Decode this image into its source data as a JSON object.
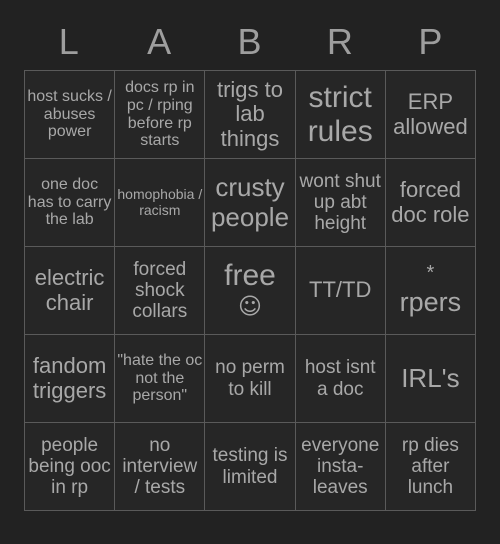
{
  "card": {
    "header_letters": [
      "L",
      "A",
      "B",
      "R",
      "P"
    ],
    "colors": {
      "background": "#222222",
      "cell_fill": "#262626",
      "border": "#5a5a5a",
      "text": "#a8a8a8",
      "header_text": "#9e9e9e"
    },
    "rows": [
      [
        {
          "text": "host sucks / abuses power",
          "size": "fs-s"
        },
        {
          "text": "docs rp in pc / rping before rp starts",
          "size": "fs-s"
        },
        {
          "text": "trigs to lab things",
          "size": "fs-l"
        },
        {
          "text": "strict rules",
          "size": "fs-xxl"
        },
        {
          "text": "ERP allowed",
          "size": "fs-l"
        }
      ],
      [
        {
          "text": "one doc has to carry the lab",
          "size": "fs-s"
        },
        {
          "text": "homophobia / racism",
          "size": "fs-xs"
        },
        {
          "text": "crusty people",
          "size": "fs-xl"
        },
        {
          "text": "wont shut up abt height",
          "size": "fs-m"
        },
        {
          "text": "forced doc role",
          "size": "fs-l"
        }
      ],
      [
        {
          "text": "electric chair",
          "size": "fs-l"
        },
        {
          "text": "forced shock collars",
          "size": "fs-m"
        },
        {
          "text": "free",
          "size": "fs-xxl",
          "free": true,
          "smiley": "☺"
        },
        {
          "text": "TT/TD",
          "size": "fs-l"
        },
        {
          "text": "rpers",
          "size": "fs-xl",
          "star": "*"
        }
      ],
      [
        {
          "text": "fandom triggers",
          "size": "fs-l"
        },
        {
          "text": "\"hate the oc not the person\"",
          "size": "fs-s"
        },
        {
          "text": "no perm to kill",
          "size": "fs-m"
        },
        {
          "text": "host isnt a doc",
          "size": "fs-m"
        },
        {
          "text": "IRL's",
          "size": "fs-xl"
        }
      ],
      [
        {
          "text": "people being ooc in rp",
          "size": "fs-m"
        },
        {
          "text": "no interview / tests",
          "size": "fs-m"
        },
        {
          "text": "testing is limited",
          "size": "fs-m"
        },
        {
          "text": "everyone insta-leaves",
          "size": "fs-m"
        },
        {
          "text": "rp dies after lunch",
          "size": "fs-m"
        }
      ]
    ]
  }
}
